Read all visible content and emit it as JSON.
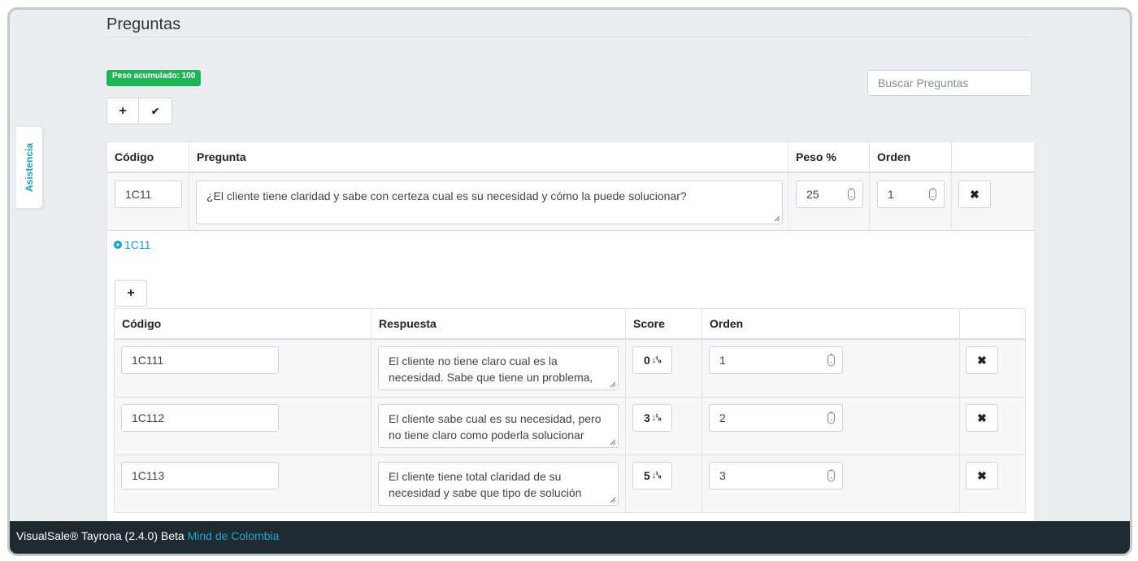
{
  "side_tab": {
    "label": "Asistencia"
  },
  "page": {
    "title": "Preguntas"
  },
  "peso_badge": "Peso acumulado: 100",
  "search": {
    "placeholder": "Buscar Preguntas",
    "value": ""
  },
  "toolbar": {
    "add_icon": "+",
    "confirm_icon": "✔"
  },
  "question_table": {
    "headers": {
      "code": "Código",
      "question": "Pregunta",
      "weight": "Peso %",
      "order": "Orden"
    },
    "row": {
      "code": "1C11",
      "question": "¿El cliente tiene claridad y sabe con certeza cual es su necesidad y cómo la puede solucionar?",
      "weight": "25",
      "order": "1",
      "delete_icon": "✖"
    }
  },
  "answers_section": {
    "toggle_label": "1C11",
    "add_icon": "+",
    "headers": {
      "code": "Código",
      "answer": "Respuesta",
      "score": "Score",
      "order": "Orden"
    },
    "rows": [
      {
        "code": "1C111",
        "answer": "El cliente no tiene claro cual es la necesidad. Sabe que tiene un problema, pero no identifica con exactitud cual",
        "score": "0",
        "order": "1",
        "delete_icon": "✖"
      },
      {
        "code": "1C112",
        "answer": "El cliente sabe cual es su necesidad, pero no tiene claro como poderla solucionar",
        "score": "3",
        "order": "2",
        "delete_icon": "✖"
      },
      {
        "code": "1C113",
        "answer": "El cliente tiene total claridad de su necesidad y sabe que tipo de solución requiere",
        "score": "5",
        "order": "3",
        "delete_icon": "✖"
      }
    ]
  },
  "footer": {
    "product": "VisualSale® Tayrona (2.4.0) Beta",
    "company": "Mind de Colombia"
  },
  "colors": {
    "accent": "#17a2c4",
    "badge": "#1fb65a",
    "footer_bg": "#1f2a30"
  }
}
